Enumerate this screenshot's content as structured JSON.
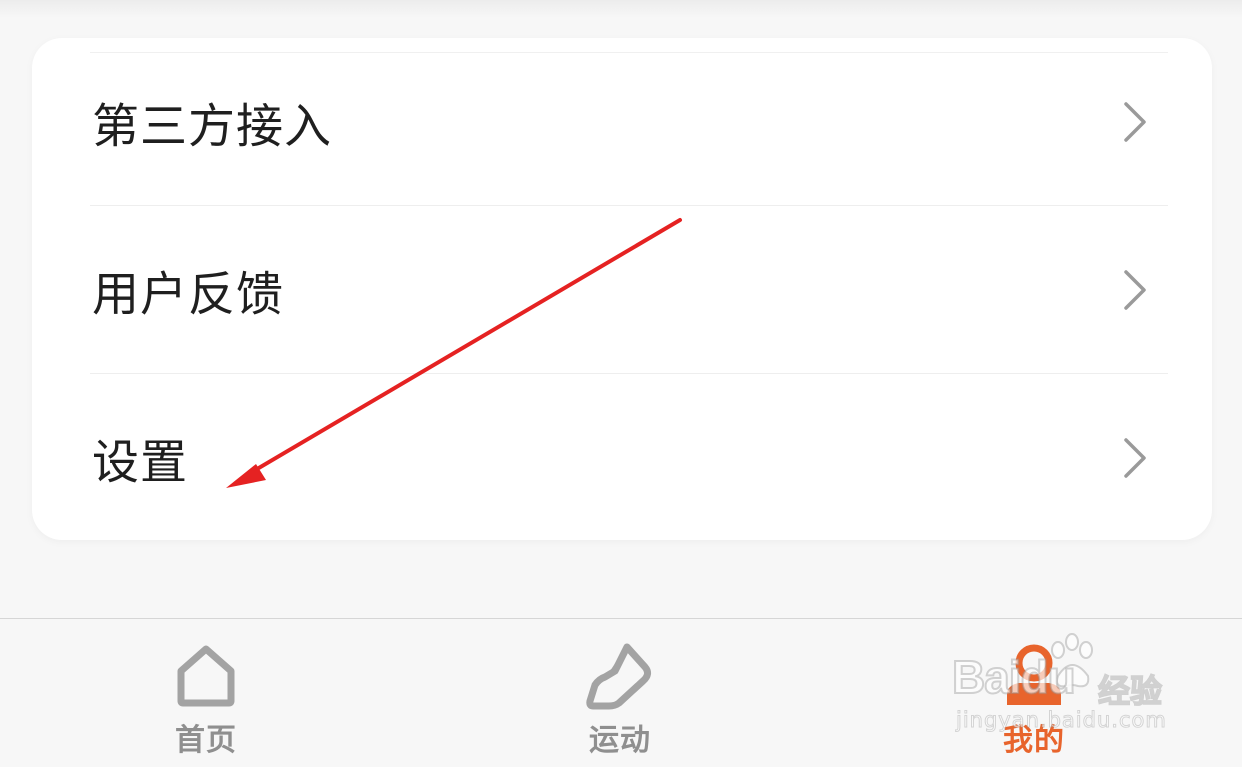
{
  "menu": {
    "items": [
      {
        "label": "第三方接入"
      },
      {
        "label": "用户反馈"
      },
      {
        "label": "设置"
      }
    ]
  },
  "tabbar": {
    "tabs": [
      {
        "label": "首页",
        "icon": "home-icon",
        "active": false
      },
      {
        "label": "运动",
        "icon": "sneaker-icon",
        "active": false
      },
      {
        "label": "我的",
        "icon": "user-icon",
        "active": true
      }
    ]
  },
  "watermark": {
    "brand": "Baidu",
    "suffix": "经验",
    "url": "jingyan.baidu.com"
  },
  "colors": {
    "accent": "#e8642c",
    "inactive_tab": "#8f8f8f",
    "annotation": "#e52222",
    "text": "#1f1f1f"
  }
}
